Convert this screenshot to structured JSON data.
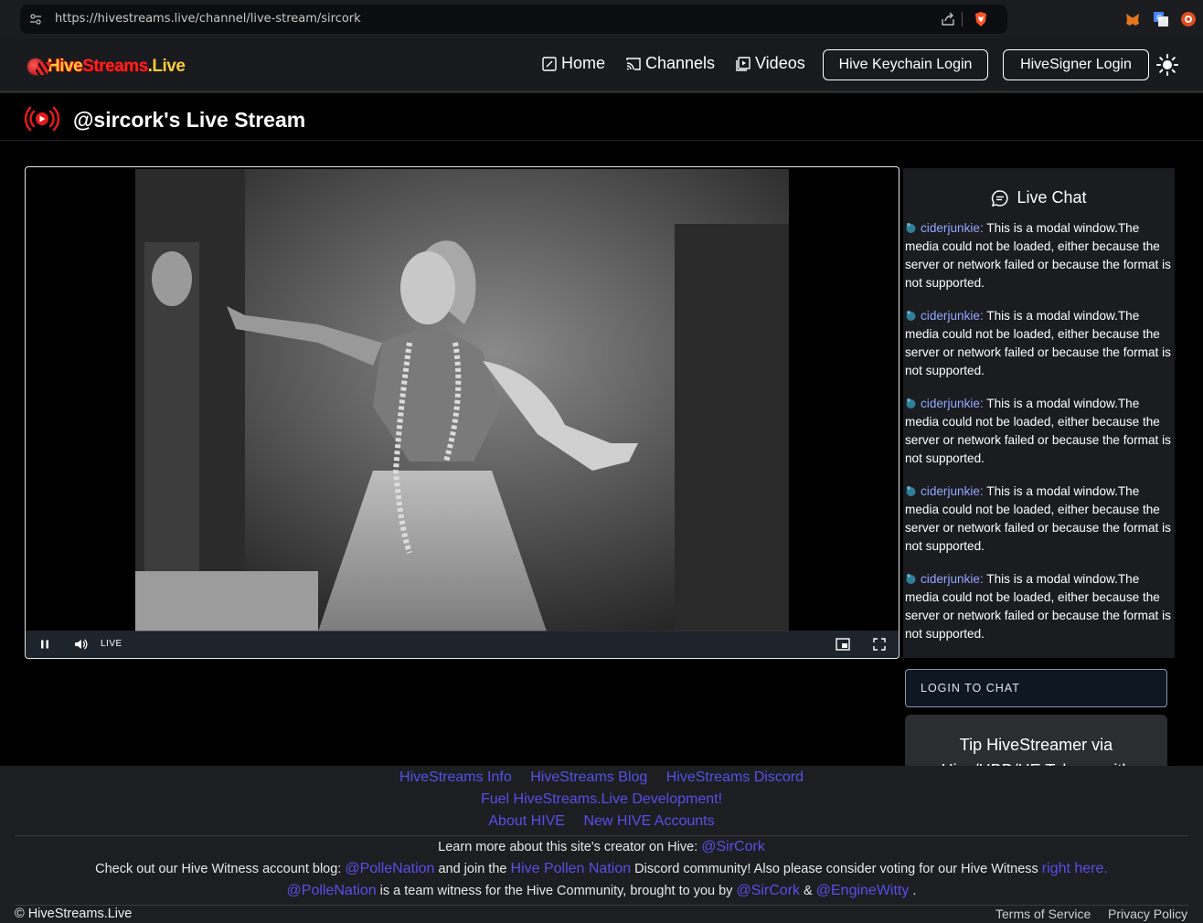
{
  "browser": {
    "url": "https://hivestreams.live/channel/live-stream/sircork",
    "icons": [
      "site-info-icon",
      "share-icon",
      "brave-shield-icon",
      "metamask-icon",
      "translate-icon",
      "extension-icon"
    ]
  },
  "header": {
    "logo": {
      "hive": "Hive",
      "streams": "Streams",
      "live": ".Live"
    },
    "nav": [
      {
        "label": "Home",
        "icon": "edit-square-icon"
      },
      {
        "label": "Channels",
        "icon": "cast-icon"
      },
      {
        "label": "Videos",
        "icon": "video-library-icon"
      }
    ],
    "keychain_login": "Hive Keychain Login",
    "hivesigner_login": "HiveSigner Login",
    "theme_icon": "sun-icon"
  },
  "page": {
    "title": "@sircork's Live Stream"
  },
  "player": {
    "live_label": "LIVE",
    "icons": [
      "pause-icon",
      "volume-icon",
      "picture-in-picture-icon",
      "fullscreen-icon"
    ]
  },
  "chat": {
    "title": "Live Chat",
    "messages": [
      {
        "user": "ciderjunkie:",
        "text": " This is a modal window.The media could not be loaded, either because the server or network failed or because the format is not supported."
      },
      {
        "user": "ciderjunkie:",
        "text": " This is a modal window.The media could not be loaded, either because the server or network failed or because the format is not supported."
      },
      {
        "user": "ciderjunkie:",
        "text": " This is a modal window.The media could not be loaded, either because the server or network failed or because the format is not supported."
      },
      {
        "user": "ciderjunkie:",
        "text": " This is a modal window.The media could not be loaded, either because the server or network failed or because the format is not supported."
      },
      {
        "user": "ciderjunkie:",
        "text": " This is a modal window.The media could not be loaded, either because the server or network failed or because the format is not supported."
      }
    ],
    "login_button": "LOGIN TO CHAT",
    "tip_line1": "Tip HiveStreamer via",
    "tip_line2": "Hive/HBD/HE Tokens with"
  },
  "footer": {
    "links_row1": [
      "HiveStreams Info",
      "HiveStreams Blog",
      "HiveStreams Discord"
    ],
    "links_row2": [
      "Fuel HiveStreams.Live Development!"
    ],
    "links_row3": [
      "About HIVE",
      "New HIVE Accounts"
    ],
    "creator_text": "Learn more about this site's creator on Hive: ",
    "creator_link": "@SirCork",
    "witness_pre": "Check out our Hive Witness account blog: ",
    "witness_link": "@PolleNation",
    "witness_mid": " and join the ",
    "discord_link": "Hive Pollen Nation",
    "witness_post": " Discord community! Also please consider voting for our Hive Witness ",
    "vote_link": "right here.",
    "team_link": "@PolleNation",
    "team_text": " is a team witness for the Hive Community, brought to you by ",
    "sircork_link": "@SirCork",
    "amp": " & ",
    "engine_link": "@EngineWitty",
    "period": " .",
    "copyright": "© HiveStreams.Live",
    "terms": "Terms of Service",
    "privacy": "Privacy Policy"
  },
  "colors": {
    "accent": "#5a4ee8",
    "chat_user": "#8fa7ff",
    "live_red": "#e51b1b"
  }
}
